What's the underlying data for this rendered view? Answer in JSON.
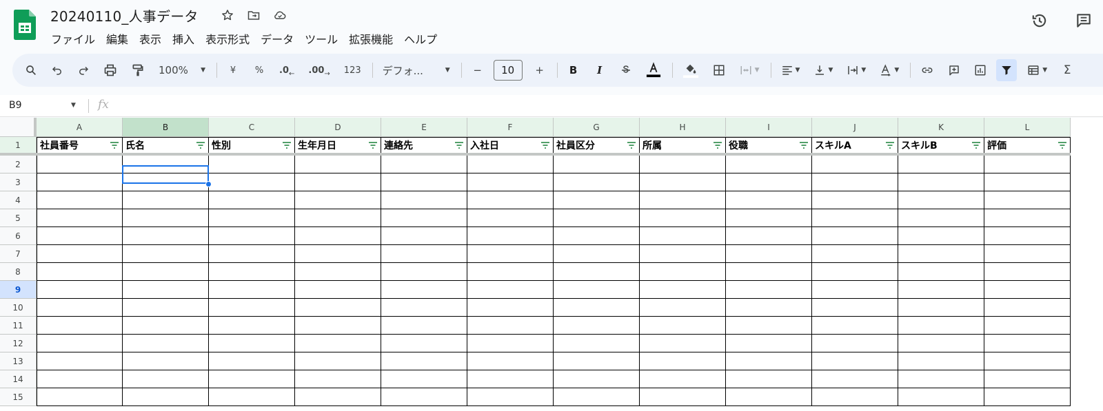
{
  "app": {
    "doc_title": "20240110_人事データ",
    "menu": [
      "ファイル",
      "編集",
      "表示",
      "挿入",
      "表示形式",
      "データ",
      "ツール",
      "拡張機能",
      "ヘルプ"
    ]
  },
  "toolbar": {
    "zoom": "100%",
    "currency": "¥",
    "percent": "%",
    "decimal_decrease": ".0",
    "decimal_increase": ".00",
    "more_formats": "123",
    "font": "デフォ...",
    "font_size": "10",
    "minus": "−",
    "plus": "+",
    "bold": "B",
    "italic": "I",
    "sum": "Σ"
  },
  "formula_bar": {
    "name_box": "B9",
    "fx": "fx",
    "value": ""
  },
  "sheet": {
    "columns": [
      "A",
      "B",
      "C",
      "D",
      "E",
      "F",
      "G",
      "H",
      "I",
      "J",
      "K",
      "L"
    ],
    "rows": [
      "1",
      "2",
      "3",
      "4",
      "5",
      "6",
      "7",
      "8",
      "9",
      "10",
      "11",
      "12",
      "13",
      "14",
      "15"
    ],
    "header_cells": [
      "社員番号",
      "氏名",
      "性別",
      "生年月日",
      "連絡先",
      "入社日",
      "社員区分",
      "所属",
      "役職",
      "スキルA",
      "スキルB",
      "評価"
    ],
    "selected_cell": "B9",
    "selected_column": "B",
    "selected_row": "9"
  },
  "colors": {
    "accent": "#1a73e8",
    "sheets_green": "#0f9d58",
    "header_green": "#e6f4ea",
    "toolbar_bg": "#edf2fa"
  }
}
